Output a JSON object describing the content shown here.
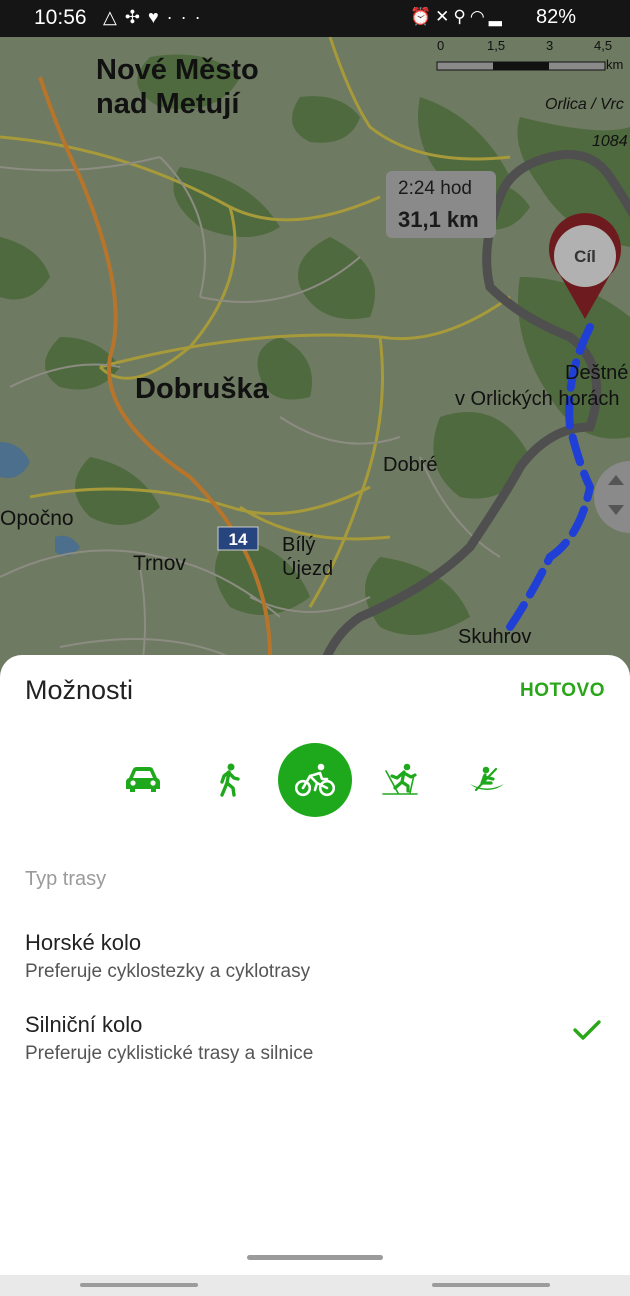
{
  "status_bar": {
    "time": "10:56",
    "left_icons": [
      "triangle-alert-icon",
      "fan-icon",
      "heart-icon",
      "more-dots-icon"
    ],
    "right_icons": [
      "alarm-icon",
      "mute-icon",
      "location-icon",
      "wifi-icon",
      "signal-icon"
    ],
    "battery": "82%"
  },
  "map": {
    "places": {
      "nove_mesto_1": "Nové Město",
      "nove_mesto_2": "nad Metují",
      "dobruska": "Dobruška",
      "dobre": "Dobré",
      "opocno": "Opočno",
      "trnov": "Trnov",
      "bily_1": "Bílý",
      "bily_2": "Újezd",
      "skuhrov": "Skuhrov",
      "destne_1": "Deštné",
      "destne_2": "v Orlických horách",
      "orlica": "Orlica / Vrc",
      "elev": "1084"
    },
    "road_number": "14",
    "scale": {
      "t0": "0",
      "t1": "1,5",
      "t2": "3",
      "t3": "4,5",
      "unit": "km"
    },
    "route_info": {
      "time": "2:24 hod",
      "distance": "31,1 km"
    },
    "destination_label": "Cíl"
  },
  "sheet": {
    "title": "Možnosti",
    "done_label": "HOTOVO",
    "modes": [
      {
        "name": "car",
        "icon": "car-icon",
        "active": false
      },
      {
        "name": "walk",
        "icon": "walking-icon",
        "active": false
      },
      {
        "name": "bike",
        "icon": "bicycle-icon",
        "active": true
      },
      {
        "name": "ski",
        "icon": "cross-country-ski-icon",
        "active": false
      },
      {
        "name": "boat",
        "icon": "canoe-icon",
        "active": false
      }
    ],
    "section_label": "Typ trasy",
    "options": [
      {
        "title": "Horské kolo",
        "subtitle": "Preferuje cyklostezky a cyklotrasy",
        "selected": false
      },
      {
        "title": "Silniční kolo",
        "subtitle": "Preferuje cyklistické trasy a silnice",
        "selected": true
      }
    ]
  },
  "colors": {
    "accent": "#1ea81b",
    "done_text": "#2aa619",
    "route_dark": "#555555",
    "route_blue": "#1f3fd6",
    "pin_red": "#b0262e"
  }
}
